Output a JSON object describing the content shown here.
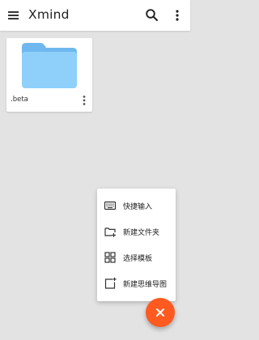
{
  "app": {
    "title": "Xmind"
  },
  "icons": {
    "menu": "hamburger-menu-icon",
    "search": "search-icon",
    "more": "more-vert-icon",
    "folder": "folder-icon",
    "close": "close-icon"
  },
  "files": [
    {
      "name": ".beta",
      "type": "folder"
    }
  ],
  "fab_menu": {
    "items": [
      {
        "label": "快捷输入",
        "icon": "keyboard-icon"
      },
      {
        "label": "新建文件夹",
        "icon": "new-folder-icon"
      },
      {
        "label": "选择模板",
        "icon": "template-grid-icon"
      },
      {
        "label": "新建思维导图",
        "icon": "new-mindmap-icon"
      }
    ]
  },
  "colors": {
    "accent": "#ff5a1f",
    "folder": "#7cc3f7",
    "background": "#e3e3e3",
    "surface": "#ffffff"
  }
}
